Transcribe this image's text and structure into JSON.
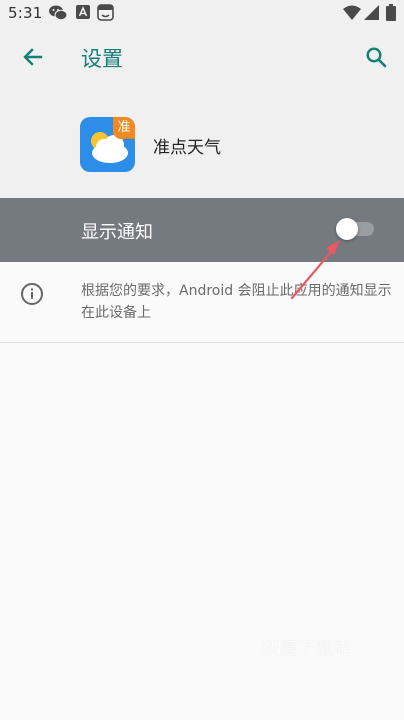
{
  "status_bar": {
    "time": "5:31",
    "left_icons": [
      "wechat-icon",
      "a-square-icon",
      "face-box-icon"
    ],
    "right_icons": [
      "wifi-icon",
      "signal-icon",
      "battery-icon"
    ]
  },
  "toolbar": {
    "title": "设置",
    "back_icon": "arrow-left-icon",
    "search_icon": "search-icon"
  },
  "app": {
    "name": "准点天气",
    "badge": "准",
    "icon": "weather-cloud-icon"
  },
  "notification": {
    "label": "显示通知",
    "switch_on": false
  },
  "info": {
    "icon": "info-icon",
    "text": "根据您的要求，Android 会阻止此应用的通知显示在此设备上"
  },
  "watermark": "沃瘦下载站",
  "colors": {
    "accent": "#137f79",
    "row_highlight": "#757a80",
    "arrow": "#e8595f",
    "app_icon_bg": "#2c8ee8",
    "badge_bg": "#f28a21"
  }
}
